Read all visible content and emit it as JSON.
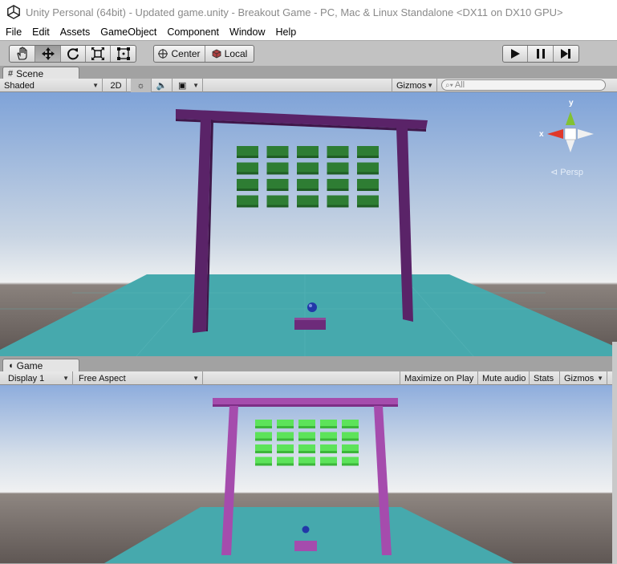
{
  "window": {
    "title": "Unity Personal (64bit) - Updated game.unity - Breakout Game - PC, Mac & Linux Standalone <DX11 on DX10 GPU>"
  },
  "menu": [
    "File",
    "Edit",
    "Assets",
    "GameObject",
    "Component",
    "Window",
    "Help"
  ],
  "toolbar": {
    "tools": [
      "hand-tool",
      "move-tool",
      "rotate-tool",
      "scale-tool",
      "rect-tool"
    ],
    "active_tool": "move-tool",
    "pivot_mode": "Center",
    "pivot_rotation": "Local",
    "play_controls": [
      "play",
      "pause",
      "step"
    ]
  },
  "scene": {
    "tab_label": "Scene",
    "shading_mode": "Shaded",
    "mode_2d": "2D",
    "gizmos_label": "Gizmos",
    "search_placeholder": "All",
    "gizmo_axes": {
      "x": "x",
      "y": "y"
    },
    "projection": "Persp"
  },
  "game": {
    "tab_label": "Game",
    "display": "Display 1",
    "aspect": "Free Aspect",
    "maximize_on_play": "Maximize on Play",
    "mute_audio": "Mute audio",
    "stats": "Stats",
    "gizmos_label": "Gizmos"
  },
  "colors": {
    "sky_top": "#7fa3d8",
    "horizon": "#e8ecef",
    "ground": "#6a6360",
    "floor": "#46a9ad",
    "scene_frame": "#5a2368",
    "scene_brick": "#2e7d33",
    "game_frame": "#a54cad",
    "game_brick": "#5de35a",
    "ball": "#2238a8"
  },
  "bricks": {
    "rows": 4,
    "cols": 5
  }
}
